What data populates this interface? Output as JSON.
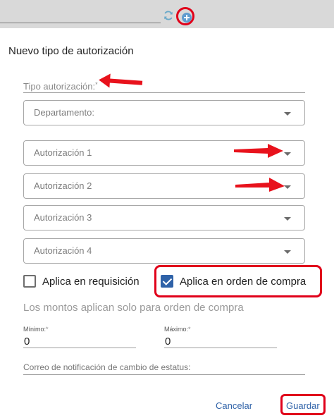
{
  "dialog": {
    "title": "Nuevo tipo de autorización"
  },
  "fields": {
    "tipo": {
      "label": "Tipo autorización:",
      "required": "*"
    },
    "departamento": {
      "label": "Departamento:"
    },
    "autorizacion_1": {
      "label": "Autorización 1"
    },
    "autorizacion_2": {
      "label": "Autorización 2"
    },
    "autorizacion_3": {
      "label": "Autorización 3"
    },
    "autorizacion_4": {
      "label": "Autorización 4"
    },
    "minimo": {
      "label": "Mínimo:",
      "required": "*",
      "value": "0"
    },
    "maximo": {
      "label": "Máximo:",
      "required": "*",
      "value": "0"
    },
    "correo": {
      "label": "Correo de notificación de cambio de estatus:"
    }
  },
  "checkboxes": {
    "requisicion": {
      "label": "Aplica en requisición",
      "checked": false
    },
    "orden_compra": {
      "label": "Aplica en orden de compra",
      "checked": true
    }
  },
  "hint": "Los montos aplican solo para orden de compra",
  "actions": {
    "cancel": "Cancelar",
    "save": "Guardar"
  },
  "icons": {
    "refresh": "refresh-icon",
    "add": "add-circle-icon"
  },
  "colors": {
    "accent": "#2f62a8",
    "annotation": "#e0001a"
  }
}
